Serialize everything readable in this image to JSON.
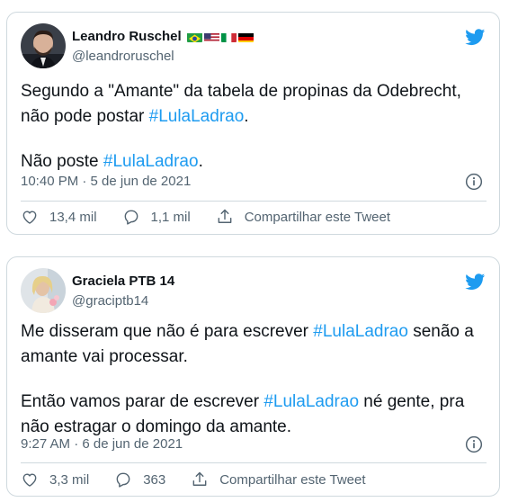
{
  "tweets": [
    {
      "author_name": "Leandro Ruschel",
      "handle": "@leandroruschel",
      "flags": [
        "Brazil",
        "USA",
        "Italy",
        "Germany"
      ],
      "text": {
        "p1_before": "Segundo a \"Amante\" da tabela de propinas da Odebrecht, não pode postar ",
        "p1_hashtag": "#LulaLadrao",
        "p1_after": ".",
        "p2_before": "Não poste ",
        "p2_hashtag": "#LulaLadrao",
        "p2_after": "."
      },
      "timestamp": "10:40 PM · 5 de jun de 2021",
      "likes": "13,4 mil",
      "replies": "1,1 mil",
      "share_label": "Compartilhar este Tweet"
    },
    {
      "author_name": "Graciela PTB 14",
      "handle": "@graciptb14",
      "text": {
        "p1_before": "Me disseram que não é para escrever ",
        "p1_hashtag": "#LulaLadrao",
        "p1_after": " senão a amante vai processar.",
        "p2_before": "Então vamos parar de escrever ",
        "p2_hashtag": "#LulaLadrao",
        "p2_after": " né gente, pra não estragar o domingo da amante."
      },
      "timestamp": "9:27 AM · 6 de jun de 2021",
      "likes": "3,3 mil",
      "replies": "363",
      "share_label": "Compartilhar este Tweet"
    }
  ],
  "colors": {
    "accent": "#1d9bf0",
    "secondary_text": "#536471",
    "border": "#cfd9de"
  }
}
